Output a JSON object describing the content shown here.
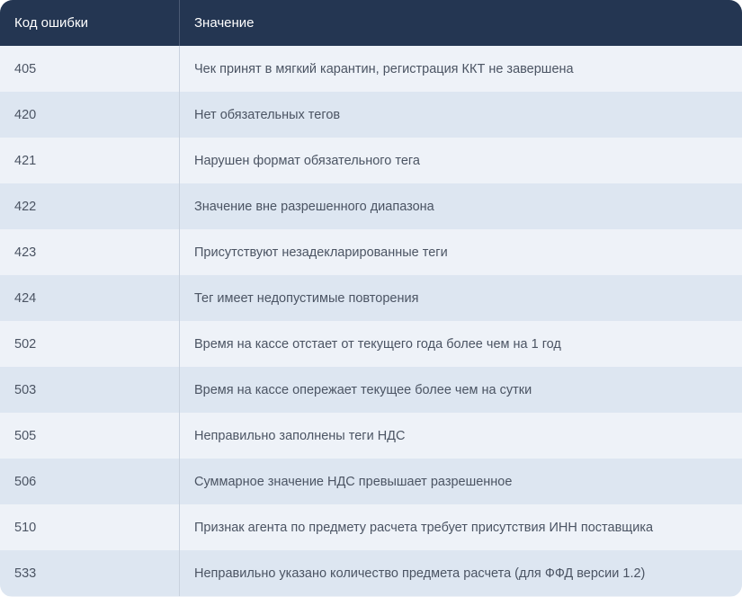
{
  "header": {
    "code": "Код ошибки",
    "value": "Значение"
  },
  "rows": [
    {
      "code": "405",
      "value": "Чек принят в мягкий карантин,  регистрация ККТ не завершена"
    },
    {
      "code": "420",
      "value": "Нет обязательных тегов"
    },
    {
      "code": "421",
      "value": "Нарушен формат обязательного тега"
    },
    {
      "code": "422",
      "value": "Значение вне разрешенного диапазона"
    },
    {
      "code": "423",
      "value": "Присутствуют незадекларированные теги"
    },
    {
      "code": "424",
      "value": "Тег имеет недопустимые повторения"
    },
    {
      "code": "502",
      "value": "Время на кассе отстает от текущего года более чем на 1 год"
    },
    {
      "code": "503",
      "value": "Время на кассе опережает текущее более чем на сутки"
    },
    {
      "code": "505",
      "value": "Неправильно заполнены теги НДС"
    },
    {
      "code": "506",
      "value": "Суммарное значение НДС превышает разрешенное"
    },
    {
      "code": "510",
      "value": "Признак агента по предмету расчета требует присутствия ИНН поставщика"
    },
    {
      "code": "533",
      "value": "Неправильно указано количество предмета расчета (для ФФД версии 1.2)"
    }
  ]
}
